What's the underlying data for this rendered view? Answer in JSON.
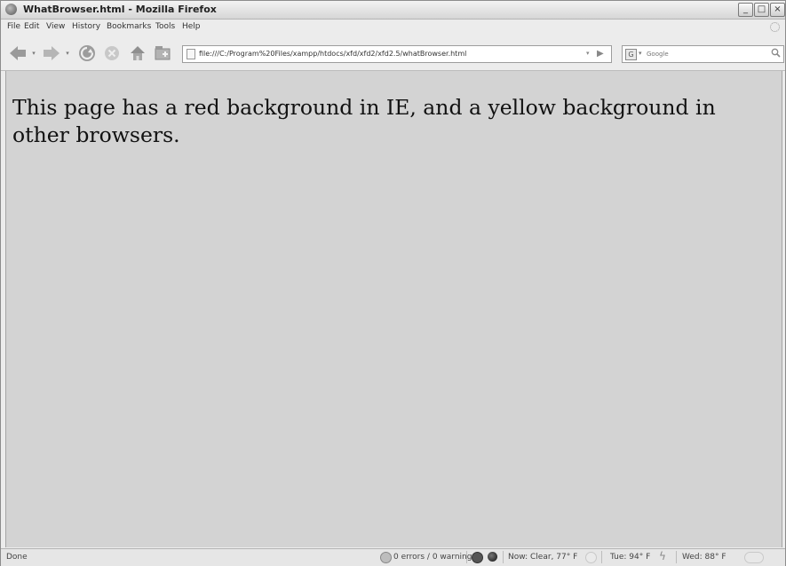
{
  "window": {
    "title": "WhatBrowser.html - Mozilla Firefox",
    "buttons": {
      "minimize": "_",
      "maximize": "□",
      "close": "×"
    }
  },
  "menu": [
    "File",
    "Edit",
    "View",
    "History",
    "Bookmarks",
    "Tools",
    "Help"
  ],
  "toolbar": {
    "back_icon": "back-arrow-icon",
    "forward_icon": "forward-arrow-icon",
    "reload_icon": "reload-icon",
    "stop_icon": "stop-icon",
    "home_icon": "home-icon",
    "new_tab_icon": "new-tab-icon",
    "url": "file:///C:/Program%20Files/xampp/htdocs/xfd/xfd2/xfd2.5/whatBrowser.html",
    "search_placeholder": "Google"
  },
  "page": {
    "text": "This page has a red background in IE, and a yellow background in other browsers."
  },
  "status": {
    "left": "Done",
    "errors": "0 errors / 0 warnings",
    "weather_now": "Now: Clear, 77° F",
    "weather_tue": "Tue: 94° F",
    "weather_wed": "Wed: 88° F"
  },
  "colors": {
    "content_bg": "#d3d3d3",
    "chrome_bg": "#ececec"
  }
}
